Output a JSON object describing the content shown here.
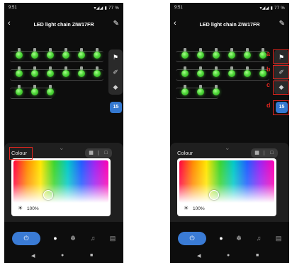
{
  "status": {
    "time": "9:51",
    "right": "▾◢◢ ▮ 77 %"
  },
  "topbar": {
    "back_icon": "back-arrow-icon",
    "title": "LED light chain ZIW17FR",
    "edit_icon": "pencil-icon"
  },
  "bulb_color": "#4fd83a",
  "toolbar": {
    "fill_icon": "paint-bucket-icon",
    "brush_icon": "brush-icon",
    "eraser_icon": "eraser-icon",
    "count": "15"
  },
  "panel": {
    "colour_label": "Colour",
    "mode_icons": [
      "color-mode-icon",
      "white-mode-icon"
    ]
  },
  "picker": {
    "selected_hue": "green",
    "cursor_fraction": 0.33,
    "brightness": "100%"
  },
  "navbar": {
    "items": [
      "power-icon",
      "bulb-icon",
      "palette-icon",
      "music-icon",
      "schedule-icon"
    ],
    "accent": "#3a7bd5"
  },
  "sysnav": {
    "back": "◀",
    "home": "●",
    "recents": "■"
  },
  "annotations": {
    "labels": [
      "a",
      "b",
      "c",
      "d"
    ],
    "color": "#e0261f"
  }
}
